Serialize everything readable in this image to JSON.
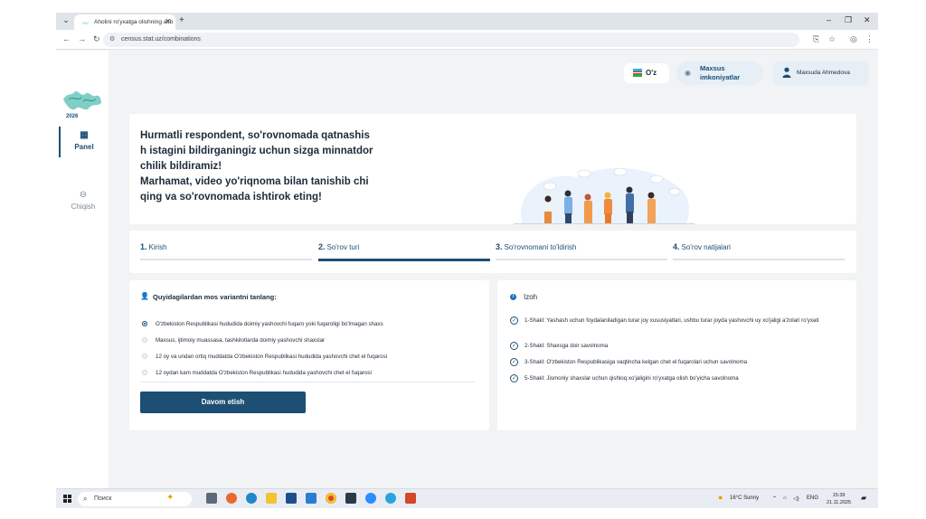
{
  "browser": {
    "tab_title": "Aholini ro'yxatga olishning asb",
    "url": "census.stat.uz/combinations"
  },
  "sidebar": {
    "logo_year": "2026",
    "items": [
      {
        "label": "Panel",
        "icon": "grid-icon"
      },
      {
        "label": "Chiqish",
        "icon": "logout-icon"
      }
    ]
  },
  "header": {
    "language": "O'z",
    "accessibility": "Maxsus imkoniyatlar",
    "user_name": "Maxsuda Ahmedova"
  },
  "hero": {
    "paragraph1": "Hurmatli respondent, so'rovnomada qatnashis\nh istagini bildirganingiz uchun sizga minnatdor\nchilik  bildiramiz!",
    "paragraph2": "Marhamat, video yo'riqnoma bilan tanishib chi\nqing va so'rovnomada ishtirok eting!"
  },
  "steps": [
    {
      "number": "1.",
      "label": "Kirish",
      "active": false
    },
    {
      "number": "2.",
      "label": "So'rov turi",
      "active": true
    },
    {
      "number": "3.",
      "label": "So'rovnomani to'ldirish",
      "active": false
    },
    {
      "number": "4.",
      "label": "So'rov natijalari",
      "active": false
    }
  ],
  "selection": {
    "title": "Quyidagilardan mos variantni tanlang:",
    "options": [
      {
        "label": "O'zbekiston Respublikasi hududida doimiy yashovchi fuqaro yoki fuqaroligi bo'lmagan shaxs",
        "checked": true
      },
      {
        "label": "Maxsus, ijtimoiy muassasa, tashkilotlarda doimiy yashovchi shaxslar",
        "checked": false
      },
      {
        "label": "12 oy va undan ortiq muddatda O'zbekiston Respublikasi hududida yashovchi chet el fuqarosi",
        "checked": false
      },
      {
        "label": "12 oydan kam muddatda O'zbekiston Respublikasi hududida yashovchi chet el fuqarosi",
        "checked": false
      }
    ],
    "continue_button": "Davom etish"
  },
  "info": {
    "title": "Izoh",
    "notes": [
      "1-Shakl: Yashash uchun foydalaniladigan turar joy xususiyatlari, ushbu turar joyda yashovchi uy xo'jaligi a'zolari ro'yxati",
      "2-Shakl: Shaxsga doir savolnoma",
      "3-Shakl: O'zbekiston Respublikasiga vaqtincha kelgan chet el fuqarolari uchun savolnoma",
      "5-Shakl: Jismoniy shaxslar uchun qishloq xo'jaligini ro'yxatga olish bo'yicha savolnoma"
    ]
  },
  "taskbar": {
    "search_placeholder": "Поиск",
    "weather": "16°C  Sunny",
    "language": "ENG",
    "time": "15:39",
    "date": "21.11.2025"
  },
  "colors": {
    "primary": "#1c4f73",
    "background": "#f1f3f5",
    "info": "#1f6fc2"
  }
}
